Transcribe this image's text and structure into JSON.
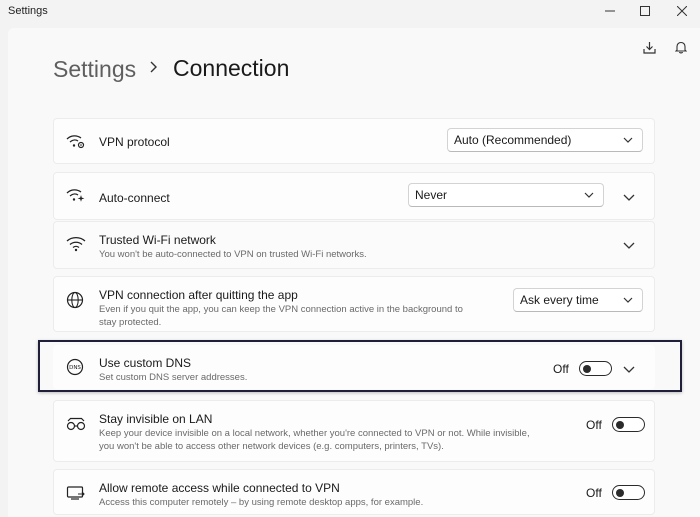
{
  "app_title": "Settings",
  "breadcrumb": {
    "root": "Settings",
    "current": "Connection"
  },
  "settings": {
    "vpn_protocol": {
      "title": "VPN protocol",
      "value": "Auto (Recommended)"
    },
    "auto_connect": {
      "title": "Auto-connect",
      "value": "Never"
    },
    "trusted_wifi": {
      "title": "Trusted Wi-Fi network",
      "description": "You won't be auto-connected to VPN on trusted Wi-Fi networks."
    },
    "after_quit": {
      "title": "VPN connection after quitting the app",
      "description_1": "Even if you quit the app, you can keep the VPN connection active in the background to",
      "description_2": "stay protected.",
      "value": "Ask every time"
    },
    "custom_dns": {
      "title": "Use custom DNS",
      "description": "Set custom DNS server addresses.",
      "state": "Off"
    },
    "invisible_lan": {
      "title": "Stay invisible on LAN",
      "description_1": "Keep your device invisible on a local network, whether you're connected to VPN or not. While invisible,",
      "description_2": "you won't be able to access other network devices (e.g. computers, printers, TVs).",
      "state": "Off"
    },
    "remote_access": {
      "title": "Allow remote access while connected to VPN",
      "description": "Access this computer remotely – by using remote desktop apps, for example.",
      "state": "Off"
    }
  },
  "icons": {
    "vpn_protocol": "wifi-gear-icon",
    "auto_connect": "wifi-sparkle-icon",
    "trusted_wifi": "wifi-icon",
    "after_quit": "globe-icon",
    "custom_dns": "dns-globe-icon",
    "invisible_lan": "glasses-icon",
    "remote_access": "remote-screen-icon"
  },
  "colors": {
    "highlight_border": "#1f1f3a",
    "toggle_off": "#2b2b2b"
  }
}
